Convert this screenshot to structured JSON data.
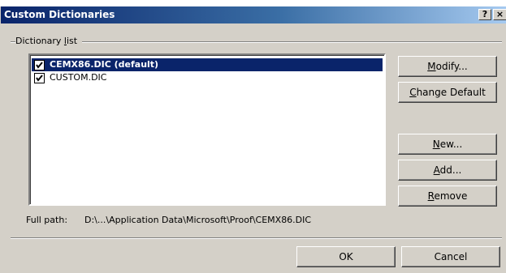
{
  "window": {
    "title": "Custom Dictionaries",
    "help_glyph": "?",
    "close_glyph": "×"
  },
  "group": {
    "label_pre": "Dictionary ",
    "label_accel": "l",
    "label_post": "ist"
  },
  "dictionaries": [
    {
      "label": "CEMX86.DIC (default)",
      "checked": true,
      "selected": true
    },
    {
      "label": "CUSTOM.DIC",
      "checked": true,
      "selected": false
    }
  ],
  "buttons": {
    "modify": {
      "accel": "M",
      "rest": "odify..."
    },
    "change_default": {
      "accel": "C",
      "rest": "hange Default"
    },
    "new": {
      "accel": "N",
      "rest": "ew..."
    },
    "add": {
      "accel": "A",
      "rest": "dd..."
    },
    "remove": {
      "accel": "R",
      "rest": "emove"
    },
    "ok": "OK",
    "cancel": "Cancel"
  },
  "full_path": {
    "label": "Full path:",
    "value": "D:\\...\\Application Data\\Microsoft\\Proof\\CEMX86.DIC"
  },
  "colors": {
    "title_bar_start": "#0a246a",
    "title_bar_end": "#a6caf0",
    "dialog_face": "#d4d0c8",
    "selection": "#0a246a"
  }
}
